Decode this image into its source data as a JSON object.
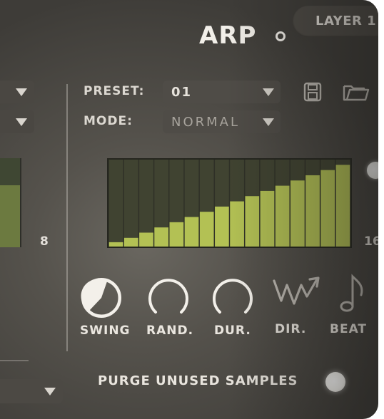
{
  "header": {
    "title": "ARP",
    "layer_tab": "LAYER 1"
  },
  "controls": {
    "preset_label": "PRESET:",
    "preset_value": "01",
    "mode_label": "MODE:",
    "mode_value": "NORMAL"
  },
  "left_panel": {
    "step_count": "8"
  },
  "sequencer": {
    "length_label": "16",
    "step_levels": [
      0.05,
      0.1,
      0.16,
      0.22,
      0.28,
      0.34,
      0.4,
      0.46,
      0.52,
      0.58,
      0.64,
      0.7,
      0.76,
      0.82,
      0.88,
      0.94
    ],
    "colors": {
      "bar": "#b3c154",
      "track": "#404331"
    }
  },
  "knobs": {
    "swing": "SWING",
    "rand": "RAND.",
    "dur": "DUR.",
    "dir": "DIR.",
    "beat": "BEAT"
  },
  "footer": {
    "purge_label": "PURGE UNUSED SAMPLES"
  },
  "icons": {
    "save": "floppy-disk-icon",
    "open": "folder-icon",
    "direction": "zigzag-arrow-icon",
    "beat": "music-note-icon"
  }
}
